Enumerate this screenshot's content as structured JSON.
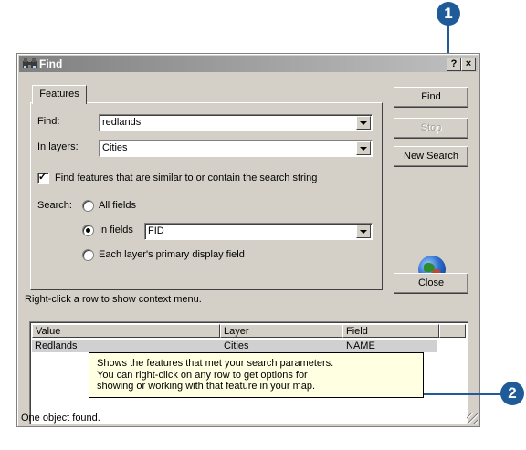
{
  "callouts": {
    "one": "1",
    "two": "2"
  },
  "window": {
    "title": "Find",
    "help_button": "?",
    "close_button": "×"
  },
  "tab": {
    "label": "Features"
  },
  "form": {
    "find_label": "Find:",
    "find_value": "redlands",
    "layers_label": "In layers:",
    "layers_value": "Cities",
    "similar_checked": true,
    "similar_label": "Find features that are similar to or contain the search string",
    "search_label": "Search:",
    "options": {
      "all_fields": "All fields",
      "in_fields": "In fields",
      "in_fields_value": "FID",
      "primary_field": "Each layer's primary display field"
    },
    "selected_option": "in_fields"
  },
  "buttons": {
    "find": "Find",
    "stop": "Stop",
    "new_search": "New Search",
    "close": "Close"
  },
  "hint": "Right-click a row to show context menu.",
  "table": {
    "columns": [
      "Value",
      "Layer",
      "Field"
    ],
    "rows": [
      {
        "value": "Redlands",
        "layer": "Cities",
        "field": "NAME"
      }
    ]
  },
  "tooltip": {
    "line1": "Shows the features that met your search parameters.",
    "line2": "You can right-click on any row to get options for",
    "line3": "showing or working with that feature in your map."
  },
  "status": "One object found.",
  "colors": {
    "callout": "#1f5b99",
    "dialog": "#d4d0c8",
    "tooltip_bg": "#ffffe1"
  },
  "icons": [
    "binoculars-icon",
    "globe-icon",
    "help-icon",
    "close-icon",
    "checkmark-icon",
    "chevron-down-icon"
  ]
}
